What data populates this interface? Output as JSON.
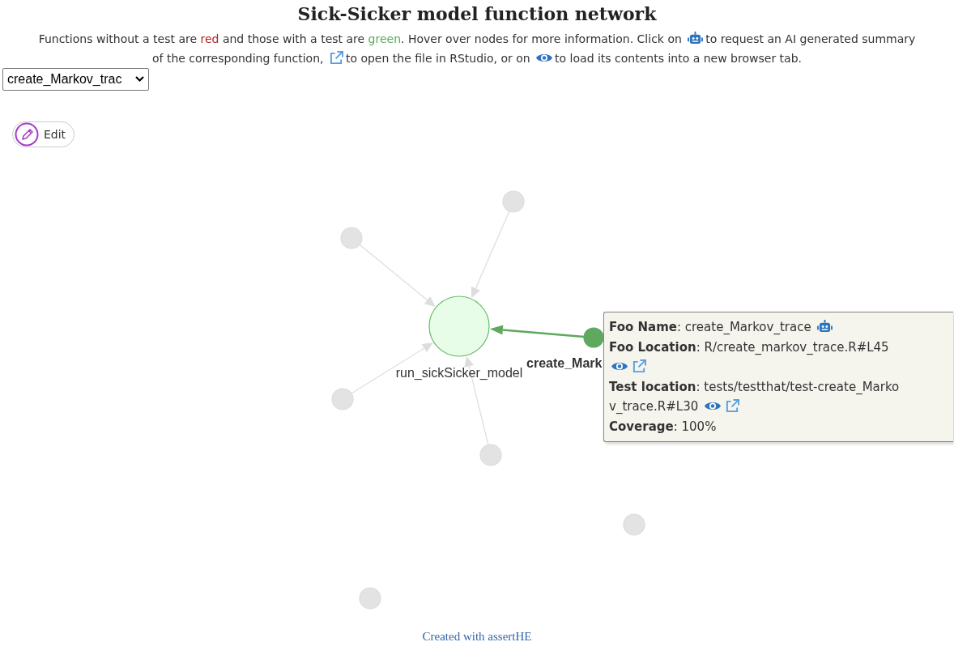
{
  "title": "Sick-Sicker model function network",
  "intro": [
    [
      {
        "kind": "text",
        "text": "Functions without a test are"
      },
      {
        "kind": "word",
        "text": "red",
        "color": "#b22222"
      },
      {
        "kind": "text",
        "text": "and those with a test are"
      },
      {
        "kind": "word",
        "text": "green",
        "color": "#5aab5a"
      },
      {
        "kind": "text",
        "text": ". Hover over nodes for more information. Click on"
      },
      {
        "kind": "robot"
      },
      {
        "kind": "text",
        "text": "to request an AI generated summary"
      }
    ],
    [
      {
        "kind": "text",
        "text": "of the corresponding function,"
      },
      {
        "kind": "link"
      },
      {
        "kind": "text",
        "text": "to open the file in RStudio, or on"
      },
      {
        "kind": "eye"
      },
      {
        "kind": "text",
        "text": "to load its contents into a new browser tab."
      }
    ]
  ],
  "select": {
    "value": "create_Markov_trac"
  },
  "edit_button": {
    "label": "Edit"
  },
  "graph": {
    "nodes": [
      {
        "kind": "tested",
        "label": "run_sickSicker_model"
      },
      {
        "kind": "selected",
        "label": "create_Mark"
      },
      {
        "kind": "faded"
      },
      {
        "kind": "faded"
      },
      {
        "kind": "faded"
      },
      {
        "kind": "faded"
      },
      {
        "kind": "faded"
      },
      {
        "kind": "faded"
      }
    ],
    "tooltip": [
      {
        "kind": "name",
        "text": "**Foo Name**: create_Markov_trace"
      },
      {
        "kind": "plain",
        "text": "**Foo Location**: R/create_markov_trace.R#L45"
      },
      {
        "kind": "file"
      },
      {
        "kind": "plain",
        "text": "**Test location**: tests/testthat/test-create_Marko"
      },
      {
        "kind": "file",
        "text": "v_trace.R#L30"
      },
      {
        "kind": "plain",
        "text": "**Coverage**: 100%"
      }
    ]
  },
  "footer": {
    "text": "Created with assertHE"
  }
}
